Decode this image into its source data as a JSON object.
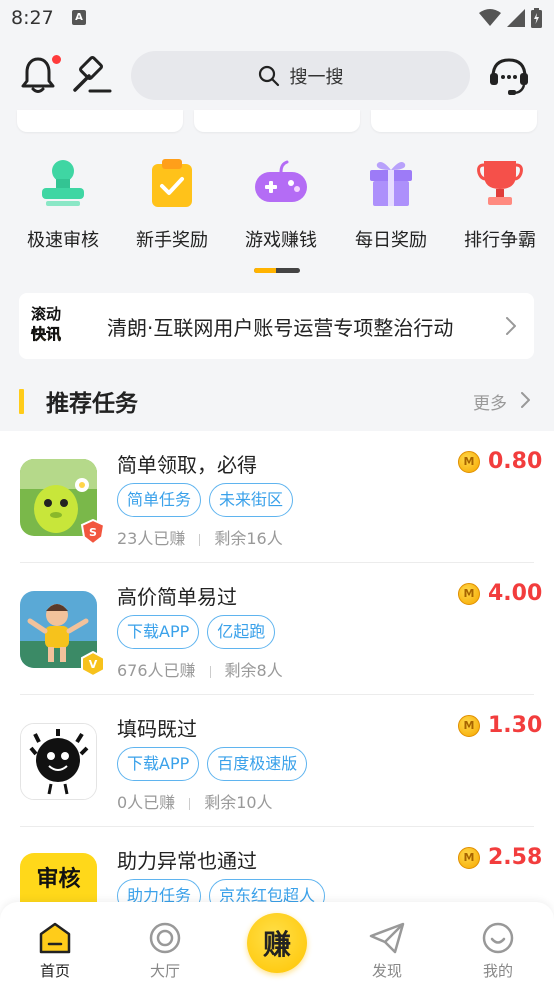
{
  "status_bar": {
    "time": "8:27",
    "notice_icon": "A"
  },
  "header": {
    "search_placeholder": "搜一搜"
  },
  "menu": [
    {
      "label": "极速审核",
      "icon": "stamp-icon",
      "color": "#3fd6a3"
    },
    {
      "label": "新手奖励",
      "icon": "clipboard-check-icon",
      "color": "#ffc21a"
    },
    {
      "label": "游戏赚钱",
      "icon": "gamepad-icon",
      "color": "#b46cf5"
    },
    {
      "label": "每日奖励",
      "icon": "gift-icon",
      "color": "#9d7bf7"
    },
    {
      "label": "排行争霸",
      "icon": "trophy-icon",
      "color": "#f5504a"
    }
  ],
  "news": {
    "badge_line1": "滚动",
    "badge_line2": "快讯",
    "text": "清朗·互联网用户账号运营专项整治行动"
  },
  "section": {
    "title": "推荐任务",
    "more": "更多"
  },
  "tasks": [
    {
      "name": "简单领取，必得",
      "tags": [
        "简单任务",
        "未来街区"
      ],
      "earned": "23人已赚",
      "remaining": "剩余16人",
      "reward": "0.80",
      "badge": "S"
    },
    {
      "name": "高价简单易过",
      "tags": [
        "下载APP",
        "亿起跑"
      ],
      "earned": "676人已赚",
      "remaining": "剩余8人",
      "reward": "4.00",
      "badge": "V"
    },
    {
      "name": "填码既过",
      "tags": [
        "下载APP",
        "百度极速版"
      ],
      "earned": "0人已赚",
      "remaining": "剩余10人",
      "reward": "1.30",
      "badge": ""
    },
    {
      "name": "助力异常也通过",
      "tags": [
        "助力任务",
        "京东红包超人"
      ],
      "earned": "",
      "remaining": "",
      "reward": "2.58",
      "badge": "",
      "thumb_text": "审核"
    }
  ],
  "coin_letter": "M",
  "tabbar": [
    {
      "label": "首页",
      "icon": "home-icon",
      "active": true
    },
    {
      "label": "大厅",
      "icon": "hall-icon",
      "active": false
    },
    {
      "label": "赚",
      "icon": "earn-icon",
      "active": false
    },
    {
      "label": "发现",
      "icon": "discover-icon",
      "active": false
    },
    {
      "label": "我的",
      "icon": "profile-icon",
      "active": false
    }
  ]
}
